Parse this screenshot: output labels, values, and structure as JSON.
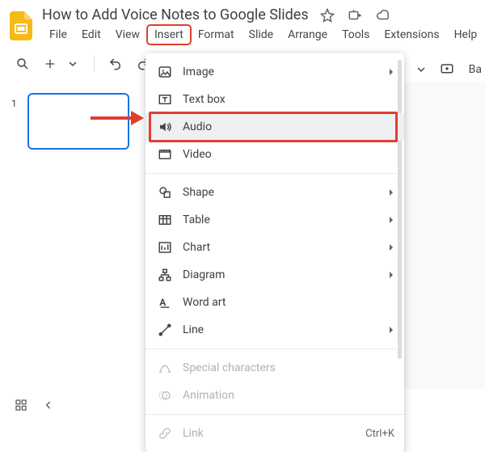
{
  "doc": {
    "title": "How to Add Voice Notes to Google Slides"
  },
  "menubar": {
    "file": "File",
    "edit": "Edit",
    "view": "View",
    "insert": "Insert",
    "format": "Format",
    "slide": "Slide",
    "arrange": "Arrange",
    "tools": "Tools",
    "extensions": "Extensions",
    "help": "Help"
  },
  "toolbar_right": {
    "background_abbrev": "Ba"
  },
  "sidebar": {
    "slide_1_num": "1"
  },
  "menu": {
    "image": "Image",
    "textbox": "Text box",
    "audio": "Audio",
    "video": "Video",
    "shape": "Shape",
    "table": "Table",
    "chart": "Chart",
    "diagram": "Diagram",
    "wordart": "Word art",
    "line": "Line",
    "special_characters": "Special characters",
    "animation": "Animation",
    "link": "Link",
    "link_shortcut": "Ctrl+K"
  }
}
